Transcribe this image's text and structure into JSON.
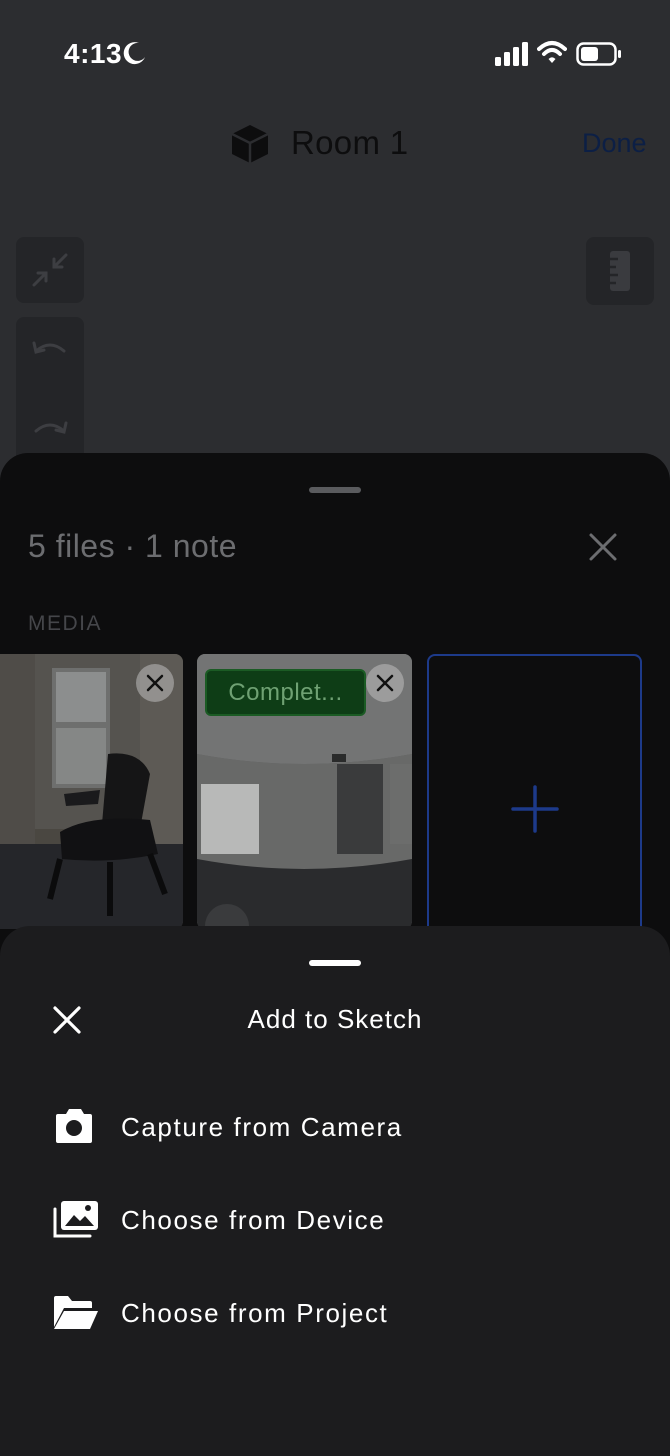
{
  "status_bar": {
    "time": "4:13"
  },
  "header": {
    "title": "Room 1",
    "done_label": "Done"
  },
  "files_sheet": {
    "summary": "5 files · 1 note",
    "section_label": "MEDIA",
    "thumbnails": [
      {
        "kind": "photo"
      },
      {
        "kind": "360-photo",
        "status": "Complet..."
      }
    ]
  },
  "add_sheet": {
    "title": "Add to Sketch",
    "options": [
      {
        "label": "Capture from Camera",
        "icon": "camera-icon"
      },
      {
        "label": "Choose from Device",
        "icon": "photo-library-icon"
      },
      {
        "label": "Choose from Project",
        "icon": "folder-open-icon"
      }
    ]
  },
  "colors": {
    "accent_blue": "#1d3a8a",
    "status_green": "#0e3d16",
    "sheet_bg": "#1c1c1e"
  }
}
